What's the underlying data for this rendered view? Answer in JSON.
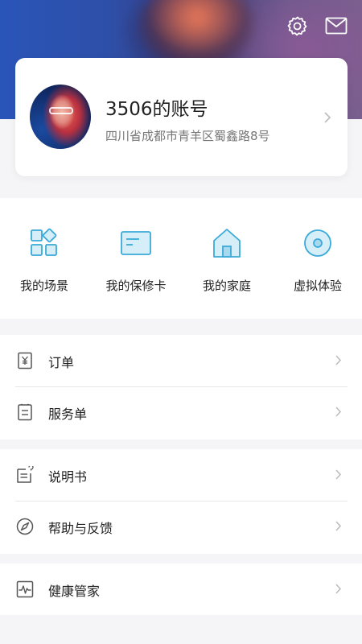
{
  "header": {
    "settings_icon": "gear-icon",
    "mail_icon": "mail-icon"
  },
  "profile": {
    "name": "3506的账号",
    "address": "四川省成都市青羊区蜀鑫路8号"
  },
  "quick_actions": [
    {
      "label": "我的场景",
      "icon": "scene-grid-icon"
    },
    {
      "label": "我的保修卡",
      "icon": "warranty-card-icon"
    },
    {
      "label": "我的家庭",
      "icon": "home-icon"
    },
    {
      "label": "虚拟体验",
      "icon": "virtual-experience-icon"
    }
  ],
  "menu": {
    "orders": {
      "label": "订单",
      "icon": "order-yen-icon"
    },
    "service": {
      "label": "服务单",
      "icon": "service-order-icon"
    },
    "manual": {
      "label": "说明书",
      "icon": "manual-icon"
    },
    "help": {
      "label": "帮助与反馈",
      "icon": "compass-icon"
    },
    "health": {
      "label": "健康管家",
      "icon": "health-pulse-icon"
    }
  },
  "colors": {
    "accent": "#3aaad8",
    "accent_fill": "#d6eef8",
    "icon_gray": "#555555",
    "chevron": "#bbbbbb"
  }
}
